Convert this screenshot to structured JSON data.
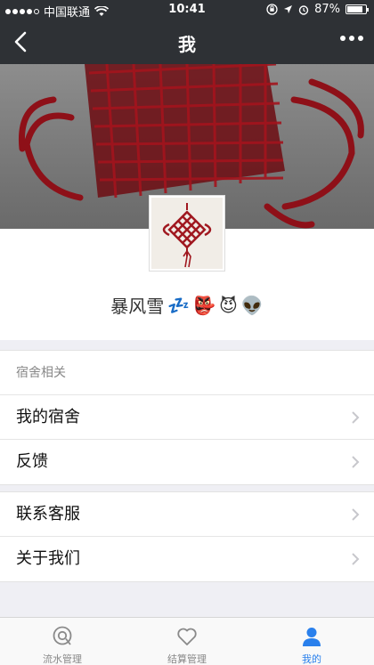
{
  "status_bar": {
    "carrier": "中国联通",
    "time": "10:41",
    "battery": "87%",
    "battery_level": 0.87
  },
  "nav": {
    "title": "我",
    "back_icon": "chevron-left-icon",
    "more_icon": "ellipsis-icon"
  },
  "profile": {
    "nickname": "暴风雪",
    "emojis": [
      "💤",
      "👺",
      "😈",
      "👽"
    ]
  },
  "groups": [
    {
      "header": "宿舍相关",
      "items": [
        {
          "label": "我的宿舍"
        },
        {
          "label": "反馈"
        }
      ]
    },
    {
      "header": "",
      "items": [
        {
          "label": "联系客服"
        },
        {
          "label": "关于我们"
        }
      ]
    }
  ],
  "tabs": [
    {
      "label": "流水管理",
      "icon": "chat-bubble-icon",
      "active": false
    },
    {
      "label": "结算管理",
      "icon": "heart-icon",
      "active": false
    },
    {
      "label": "我的",
      "icon": "person-icon",
      "active": true
    }
  ],
  "colors": {
    "header_bg": "#2e3135",
    "accent": "#2a80ec",
    "knot_red": "#8e1018"
  }
}
